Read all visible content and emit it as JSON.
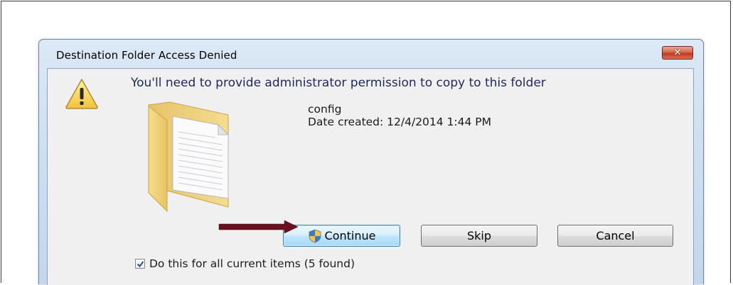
{
  "dialog": {
    "title": "Destination Folder Access Denied",
    "close_label": "✕",
    "message": "You'll need to provide administrator permission to copy to this folder",
    "file": {
      "name": "config",
      "date_created": "Date created: 12/4/2014 1:44 PM"
    },
    "buttons": {
      "continue": "Continue",
      "skip": "Skip",
      "cancel": "Cancel"
    },
    "checkbox": {
      "label": "Do this for all current items (5 found)",
      "checked": true
    }
  },
  "colors": {
    "title_bar": "#cfe0f2",
    "client_bg": "#f0f0f0",
    "close_button": "#c0391c",
    "annotation_arrow": "#6b0f1e",
    "message_text": "#1c2a5a"
  },
  "icons": [
    "warning-icon",
    "folder-icon",
    "uac-shield-icon",
    "checkmark-icon",
    "close-icon"
  ]
}
